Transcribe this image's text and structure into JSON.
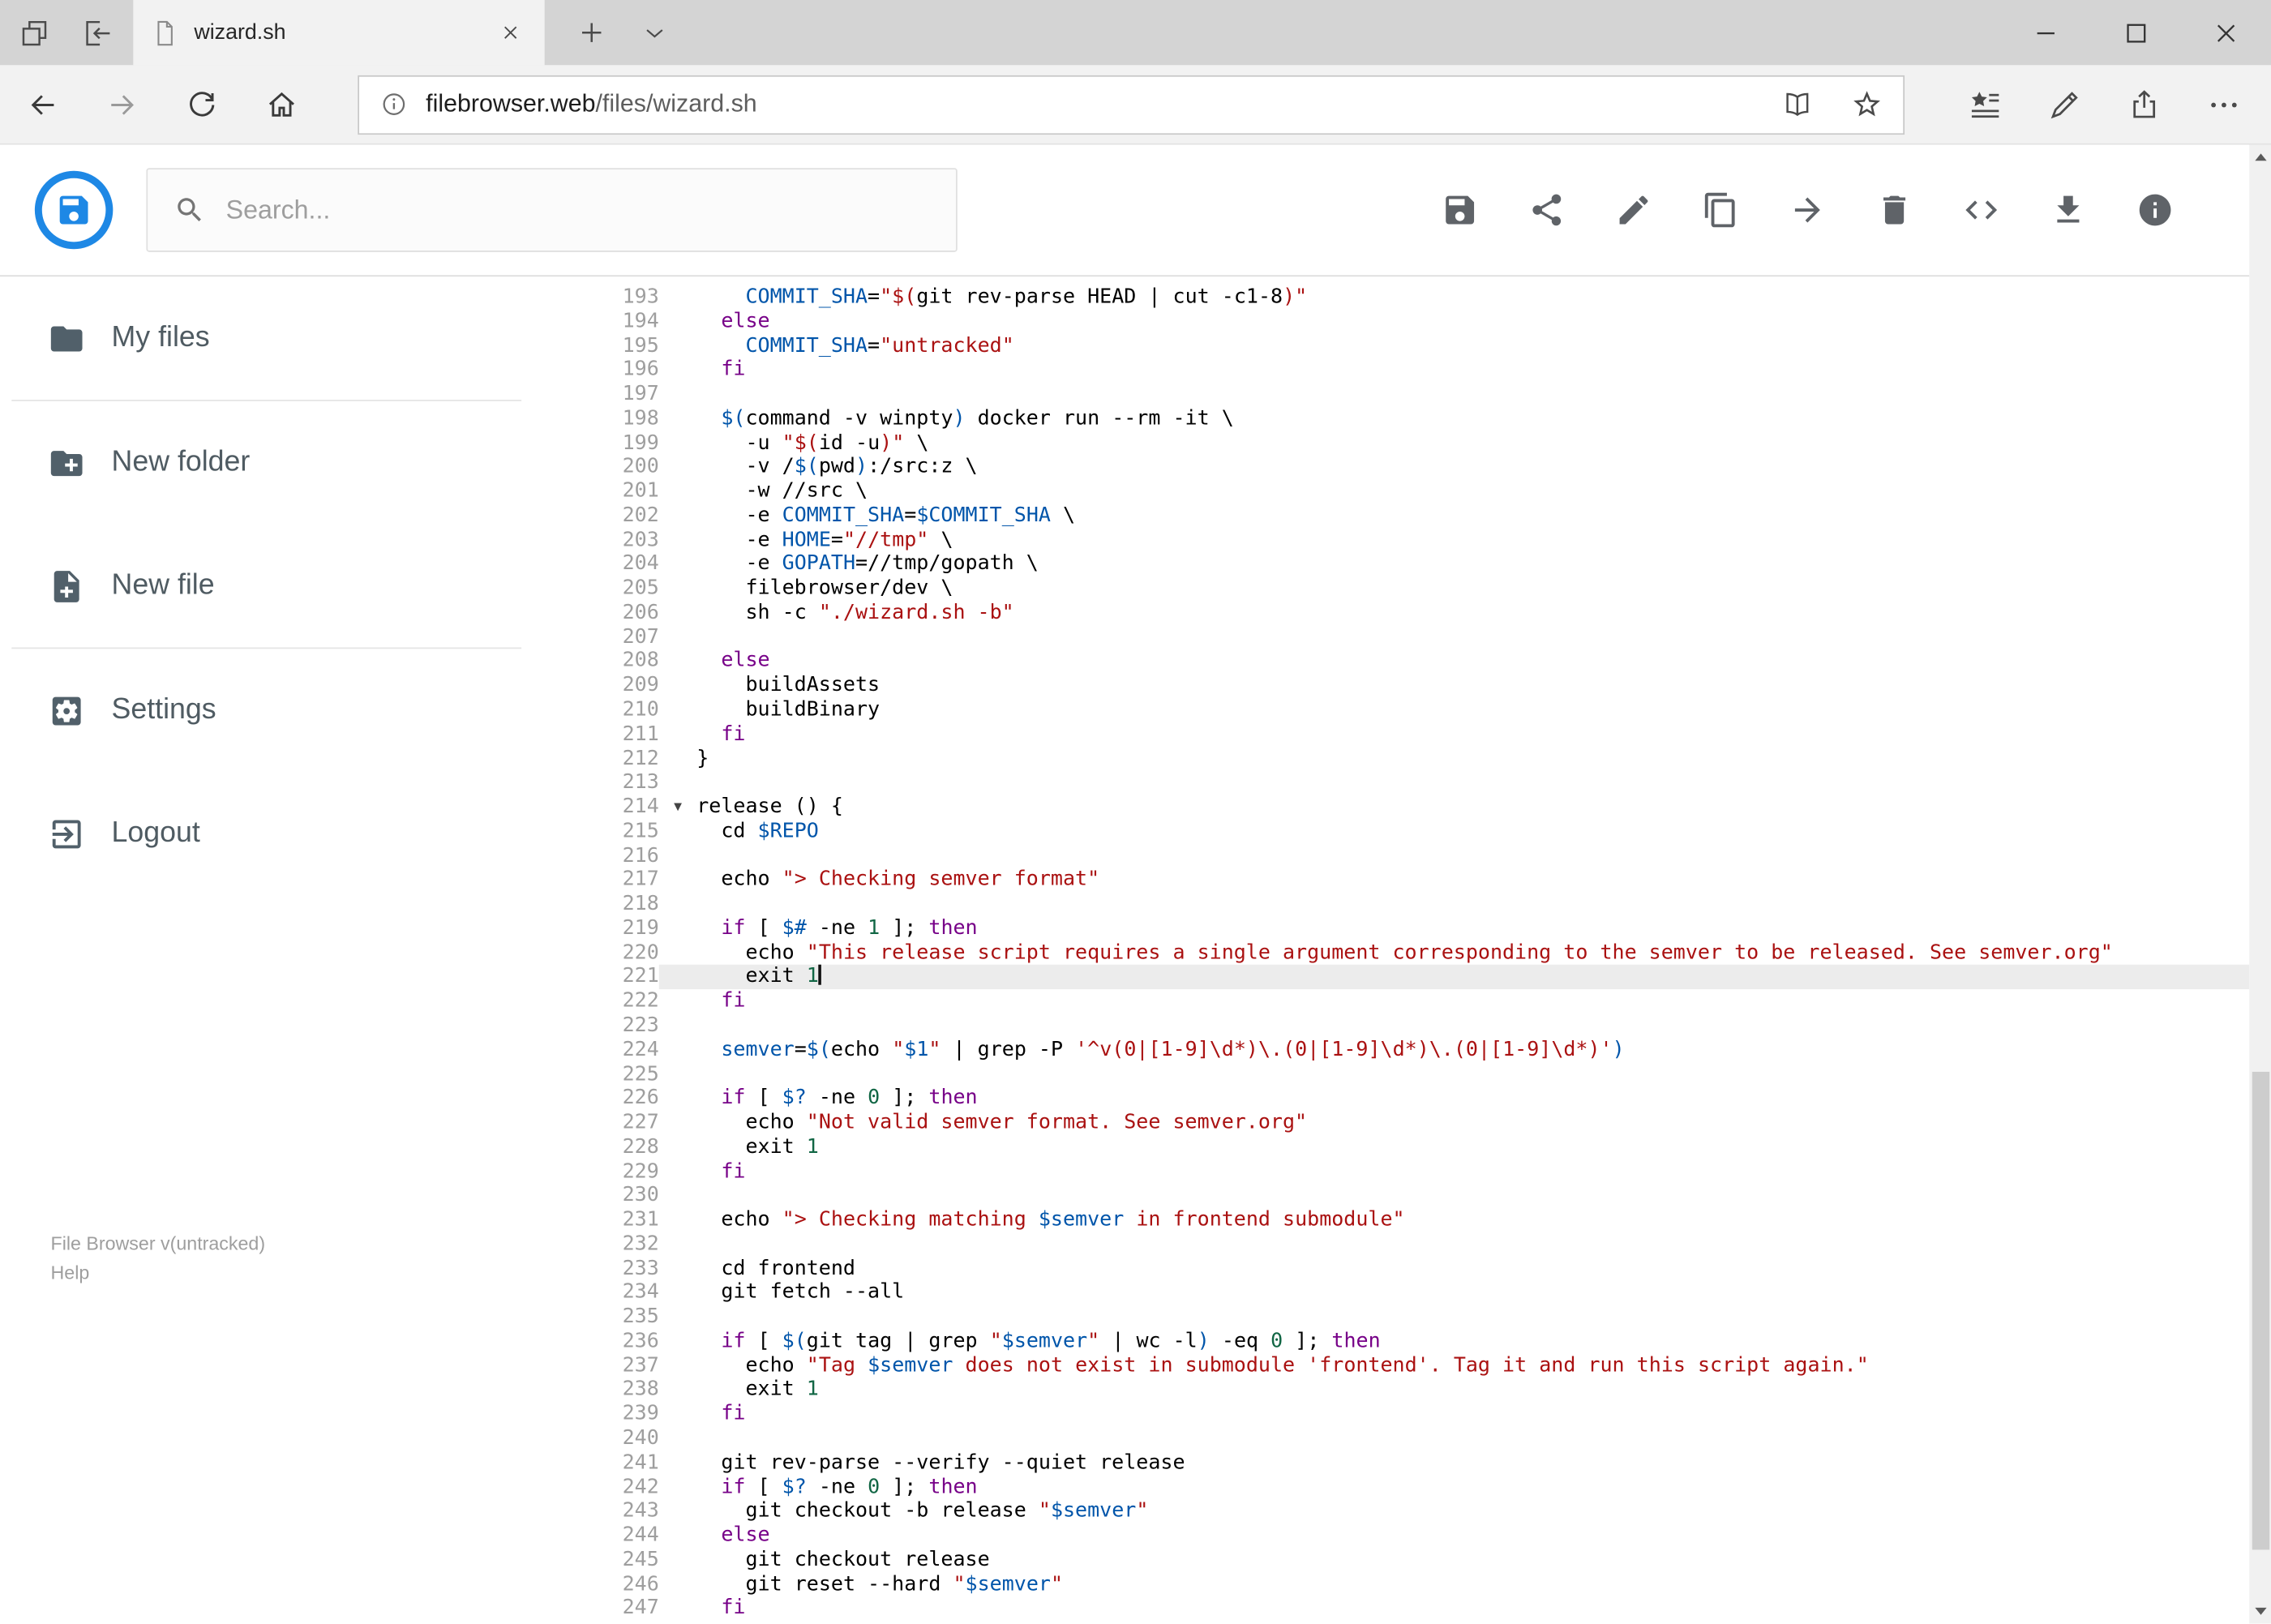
{
  "browser": {
    "tab_title": "wizard.sh",
    "url_host": "filebrowser.web",
    "url_path": "/files/wizard.sh"
  },
  "header": {
    "search_placeholder": "Search...",
    "toolbar_icons": [
      "save",
      "share",
      "rename",
      "copy",
      "move",
      "delete",
      "code",
      "download",
      "info"
    ]
  },
  "sidebar": {
    "items": [
      {
        "icon": "folder",
        "label": "My files"
      },
      {
        "icon": "create-new-folder",
        "label": "New folder"
      },
      {
        "icon": "note-add",
        "label": "New file"
      },
      {
        "icon": "settings",
        "label": "Settings"
      },
      {
        "icon": "logout",
        "label": "Logout"
      }
    ],
    "footer_version": "File Browser v(untracked)",
    "footer_help": "Help"
  },
  "editor": {
    "language": "shell",
    "active_line": 221,
    "cursor_line": 221,
    "fold_line": 214,
    "first_line": 193,
    "last_line": 247,
    "lines": [
      {
        "n": 193,
        "t": [
          [
            "p",
            "    "
          ],
          [
            "d",
            "COMMIT_SHA"
          ],
          [
            "p",
            "="
          ],
          [
            "s",
            "\"$("
          ],
          [
            "b",
            "git"
          ],
          [
            "p",
            " rev-parse HEAD | "
          ],
          [
            "b",
            "cut"
          ],
          [
            "p",
            " -c1-8"
          ],
          [
            "s",
            ")\""
          ]
        ]
      },
      {
        "n": 194,
        "t": [
          [
            "p",
            "  "
          ],
          [
            "k",
            "else"
          ]
        ]
      },
      {
        "n": 195,
        "t": [
          [
            "p",
            "    "
          ],
          [
            "d",
            "COMMIT_SHA"
          ],
          [
            "p",
            "="
          ],
          [
            "s",
            "\"untracked\""
          ]
        ]
      },
      {
        "n": 196,
        "t": [
          [
            "p",
            "  "
          ],
          [
            "k",
            "fi"
          ]
        ]
      },
      {
        "n": 197,
        "t": []
      },
      {
        "n": 198,
        "t": [
          [
            "p",
            "  "
          ],
          [
            "v",
            "$("
          ],
          [
            "p",
            "command -v winpty"
          ],
          [
            "v",
            ")"
          ],
          [
            "p",
            " docker run --rm -it \\"
          ]
        ]
      },
      {
        "n": 199,
        "t": [
          [
            "p",
            "    -u "
          ],
          [
            "s",
            "\"$("
          ],
          [
            "p",
            "id -u"
          ],
          [
            "s",
            ")\""
          ],
          [
            "p",
            " \\"
          ]
        ]
      },
      {
        "n": 200,
        "t": [
          [
            "p",
            "    -v /"
          ],
          [
            "v",
            "$("
          ],
          [
            "p",
            "pwd"
          ],
          [
            "v",
            ")"
          ],
          [
            "p",
            ":/src:z \\"
          ]
        ]
      },
      {
        "n": 201,
        "t": [
          [
            "p",
            "    -w //src \\"
          ]
        ]
      },
      {
        "n": 202,
        "t": [
          [
            "p",
            "    -e "
          ],
          [
            "d",
            "COMMIT_SHA"
          ],
          [
            "p",
            "="
          ],
          [
            "v",
            "$COMMIT_SHA"
          ],
          [
            "p",
            " \\"
          ]
        ]
      },
      {
        "n": 203,
        "t": [
          [
            "p",
            "    -e "
          ],
          [
            "d",
            "HOME"
          ],
          [
            "p",
            "="
          ],
          [
            "s",
            "\"//tmp\""
          ],
          [
            "p",
            " \\"
          ]
        ]
      },
      {
        "n": 204,
        "t": [
          [
            "p",
            "    -e "
          ],
          [
            "d",
            "GOPATH"
          ],
          [
            "p",
            "=//tmp/gopath \\"
          ]
        ]
      },
      {
        "n": 205,
        "t": [
          [
            "p",
            "    filebrowser/dev \\"
          ]
        ]
      },
      {
        "n": 206,
        "t": [
          [
            "p",
            "    "
          ],
          [
            "b",
            "sh"
          ],
          [
            "p",
            " -c "
          ],
          [
            "s",
            "\"./wizard.sh -b\""
          ]
        ]
      },
      {
        "n": 207,
        "t": []
      },
      {
        "n": 208,
        "t": [
          [
            "p",
            "  "
          ],
          [
            "k",
            "else"
          ]
        ]
      },
      {
        "n": 209,
        "t": [
          [
            "p",
            "    buildAssets"
          ]
        ]
      },
      {
        "n": 210,
        "t": [
          [
            "p",
            "    buildBinary"
          ]
        ]
      },
      {
        "n": 211,
        "t": [
          [
            "p",
            "  "
          ],
          [
            "k",
            "fi"
          ]
        ]
      },
      {
        "n": 212,
        "t": [
          [
            "p",
            "}"
          ]
        ]
      },
      {
        "n": 213,
        "t": []
      },
      {
        "n": 214,
        "t": [
          [
            "p",
            "release () {"
          ]
        ]
      },
      {
        "n": 215,
        "t": [
          [
            "p",
            "  "
          ],
          [
            "b",
            "cd"
          ],
          [
            "p",
            " "
          ],
          [
            "v",
            "$REPO"
          ]
        ]
      },
      {
        "n": 216,
        "t": []
      },
      {
        "n": 217,
        "t": [
          [
            "p",
            "  "
          ],
          [
            "b",
            "echo"
          ],
          [
            "p",
            " "
          ],
          [
            "s",
            "\"> Checking semver format\""
          ]
        ]
      },
      {
        "n": 218,
        "t": []
      },
      {
        "n": 219,
        "t": [
          [
            "p",
            "  "
          ],
          [
            "k",
            "if"
          ],
          [
            "p",
            " [ "
          ],
          [
            "v",
            "$#"
          ],
          [
            "p",
            " -ne "
          ],
          [
            "n",
            "1"
          ],
          [
            "p",
            " ]; "
          ],
          [
            "k",
            "then"
          ]
        ]
      },
      {
        "n": 220,
        "t": [
          [
            "p",
            "    "
          ],
          [
            "b",
            "echo"
          ],
          [
            "p",
            " "
          ],
          [
            "s",
            "\"This release script requires a single argument corresponding to the semver to be released. See semver.org\""
          ]
        ]
      },
      {
        "n": 221,
        "t": [
          [
            "p",
            "    exit "
          ],
          [
            "n",
            "1"
          ]
        ]
      },
      {
        "n": 222,
        "t": [
          [
            "p",
            "  "
          ],
          [
            "k",
            "fi"
          ]
        ]
      },
      {
        "n": 223,
        "t": []
      },
      {
        "n": 224,
        "t": [
          [
            "p",
            "  "
          ],
          [
            "d",
            "semver"
          ],
          [
            "p",
            "="
          ],
          [
            "v",
            "$("
          ],
          [
            "b",
            "echo"
          ],
          [
            "p",
            " "
          ],
          [
            "s",
            "\""
          ],
          [
            "v",
            "$1"
          ],
          [
            "s",
            "\""
          ],
          [
            "p",
            " | "
          ],
          [
            "b",
            "grep"
          ],
          [
            "p",
            " -P "
          ],
          [
            "s",
            "'^v(0|[1-9]\\d*)\\.(0|[1-9]\\d*)\\.(0|[1-9]\\d*)'"
          ],
          [
            "v",
            ")"
          ]
        ]
      },
      {
        "n": 225,
        "t": []
      },
      {
        "n": 226,
        "t": [
          [
            "p",
            "  "
          ],
          [
            "k",
            "if"
          ],
          [
            "p",
            " [ "
          ],
          [
            "v",
            "$?"
          ],
          [
            "p",
            " -ne "
          ],
          [
            "n",
            "0"
          ],
          [
            "p",
            " ]; "
          ],
          [
            "k",
            "then"
          ]
        ]
      },
      {
        "n": 227,
        "t": [
          [
            "p",
            "    "
          ],
          [
            "b",
            "echo"
          ],
          [
            "p",
            " "
          ],
          [
            "s",
            "\"Not valid semver format. See semver.org\""
          ]
        ]
      },
      {
        "n": 228,
        "t": [
          [
            "p",
            "    exit "
          ],
          [
            "n",
            "1"
          ]
        ]
      },
      {
        "n": 229,
        "t": [
          [
            "p",
            "  "
          ],
          [
            "k",
            "fi"
          ]
        ]
      },
      {
        "n": 230,
        "t": []
      },
      {
        "n": 231,
        "t": [
          [
            "p",
            "  "
          ],
          [
            "b",
            "echo"
          ],
          [
            "p",
            " "
          ],
          [
            "s",
            "\"> Checking matching "
          ],
          [
            "v",
            "$semver"
          ],
          [
            "s",
            " in frontend submodule\""
          ]
        ]
      },
      {
        "n": 232,
        "t": []
      },
      {
        "n": 233,
        "t": [
          [
            "p",
            "  "
          ],
          [
            "b",
            "cd"
          ],
          [
            "p",
            " frontend"
          ]
        ]
      },
      {
        "n": 234,
        "t": [
          [
            "p",
            "  "
          ],
          [
            "b",
            "git"
          ],
          [
            "p",
            " fetch --all"
          ]
        ]
      },
      {
        "n": 235,
        "t": []
      },
      {
        "n": 236,
        "t": [
          [
            "p",
            "  "
          ],
          [
            "k",
            "if"
          ],
          [
            "p",
            " [ "
          ],
          [
            "v",
            "$("
          ],
          [
            "b",
            "git"
          ],
          [
            "p",
            " tag | "
          ],
          [
            "b",
            "grep"
          ],
          [
            "p",
            " "
          ],
          [
            "s",
            "\""
          ],
          [
            "v",
            "$semver"
          ],
          [
            "s",
            "\""
          ],
          [
            "p",
            " | "
          ],
          [
            "b",
            "wc"
          ],
          [
            "p",
            " -l"
          ],
          [
            "v",
            ")"
          ],
          [
            "p",
            " -eq "
          ],
          [
            "n",
            "0"
          ],
          [
            "p",
            " ]; "
          ],
          [
            "k",
            "then"
          ]
        ]
      },
      {
        "n": 237,
        "t": [
          [
            "p",
            "    "
          ],
          [
            "b",
            "echo"
          ],
          [
            "p",
            " "
          ],
          [
            "s",
            "\"Tag "
          ],
          [
            "v",
            "$semver"
          ],
          [
            "s",
            " does not exist in submodule 'frontend'. Tag it and run this script again.\""
          ]
        ]
      },
      {
        "n": 238,
        "t": [
          [
            "p",
            "    exit "
          ],
          [
            "n",
            "1"
          ]
        ]
      },
      {
        "n": 239,
        "t": [
          [
            "p",
            "  "
          ],
          [
            "k",
            "fi"
          ]
        ]
      },
      {
        "n": 240,
        "t": []
      },
      {
        "n": 241,
        "t": [
          [
            "p",
            "  "
          ],
          [
            "b",
            "git"
          ],
          [
            "p",
            " rev-parse --verify --quiet release"
          ]
        ]
      },
      {
        "n": 242,
        "t": [
          [
            "p",
            "  "
          ],
          [
            "k",
            "if"
          ],
          [
            "p",
            " [ "
          ],
          [
            "v",
            "$?"
          ],
          [
            "p",
            " -ne "
          ],
          [
            "n",
            "0"
          ],
          [
            "p",
            " ]; "
          ],
          [
            "k",
            "then"
          ]
        ]
      },
      {
        "n": 243,
        "t": [
          [
            "p",
            "    "
          ],
          [
            "b",
            "git"
          ],
          [
            "p",
            " checkout -b release "
          ],
          [
            "s",
            "\""
          ],
          [
            "v",
            "$semver"
          ],
          [
            "s",
            "\""
          ]
        ]
      },
      {
        "n": 244,
        "t": [
          [
            "p",
            "  "
          ],
          [
            "k",
            "else"
          ]
        ]
      },
      {
        "n": 245,
        "t": [
          [
            "p",
            "    "
          ],
          [
            "b",
            "git"
          ],
          [
            "p",
            " checkout release"
          ]
        ]
      },
      {
        "n": 246,
        "t": [
          [
            "p",
            "    "
          ],
          [
            "b",
            "git"
          ],
          [
            "p",
            " reset --hard "
          ],
          [
            "s",
            "\""
          ],
          [
            "v",
            "$semver"
          ],
          [
            "s",
            "\""
          ]
        ]
      },
      {
        "n": 247,
        "t": [
          [
            "p",
            "  "
          ],
          [
            "k",
            "fi"
          ]
        ]
      }
    ]
  }
}
